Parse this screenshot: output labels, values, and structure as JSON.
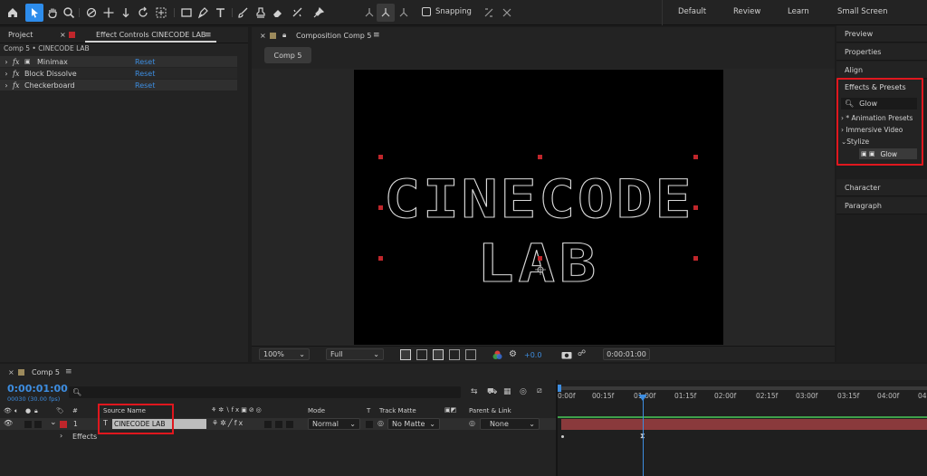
{
  "toolbar": {
    "snapping": "Snapping",
    "workspaces": [
      "Default",
      "Review",
      "Learn",
      "Small Screen"
    ]
  },
  "left_panel": {
    "tab_project": "Project",
    "tab_effect_controls": "Effect Controls CINECODE LAB",
    "path": "Comp 5 • CINECODE LAB",
    "effects": [
      {
        "name": "Minimax",
        "reset": "Reset"
      },
      {
        "name": "Block Dissolve",
        "reset": "Reset"
      },
      {
        "name": "Checkerboard",
        "reset": "Reset"
      }
    ]
  },
  "composition": {
    "tab": "Composition Comp 5",
    "comp_button": "Comp 5",
    "title_line1": "CINECODE",
    "title_line2": "LAB",
    "zoom": "100%",
    "resolution": "Full",
    "exposure": "+0.0",
    "timecode": "0:00:01:00"
  },
  "right_panel": {
    "items_top": [
      "Preview",
      "Properties",
      "Align"
    ],
    "effects_presets_title": "Effects & Presets",
    "search_value": "Glow",
    "tree": [
      "* Animation Presets",
      "Immersive Video",
      "Stylize"
    ],
    "glow_item": "Glow",
    "items_bottom": [
      "Character",
      "Paragraph"
    ]
  },
  "timeline": {
    "tab": "Comp 5",
    "current_time": "0:00:01:00",
    "fps": "00030 (30.00 fps)",
    "col_hash": "#",
    "col_source": "Source Name",
    "col_mode": "Mode",
    "col_t": "T",
    "col_track_matte": "Track Matte",
    "col_parent": "Parent & Link",
    "layer_num": "1",
    "layer_type": "T",
    "layer_name": "CINECODE LAB",
    "layer_mode": "Normal",
    "layer_matte": "No Matte",
    "layer_parent": "None",
    "effects_label": "Effects",
    "ruler": [
      "0:00f",
      "00:15f",
      "01:00f",
      "01:15f",
      "02:00f",
      "02:15f",
      "03:00f",
      "03:15f",
      "04:00f",
      "04"
    ]
  },
  "colors": {
    "accent": "#2d8ceb",
    "highlight_box": "#e0171e",
    "layer_bar": "#8a3a3c"
  }
}
